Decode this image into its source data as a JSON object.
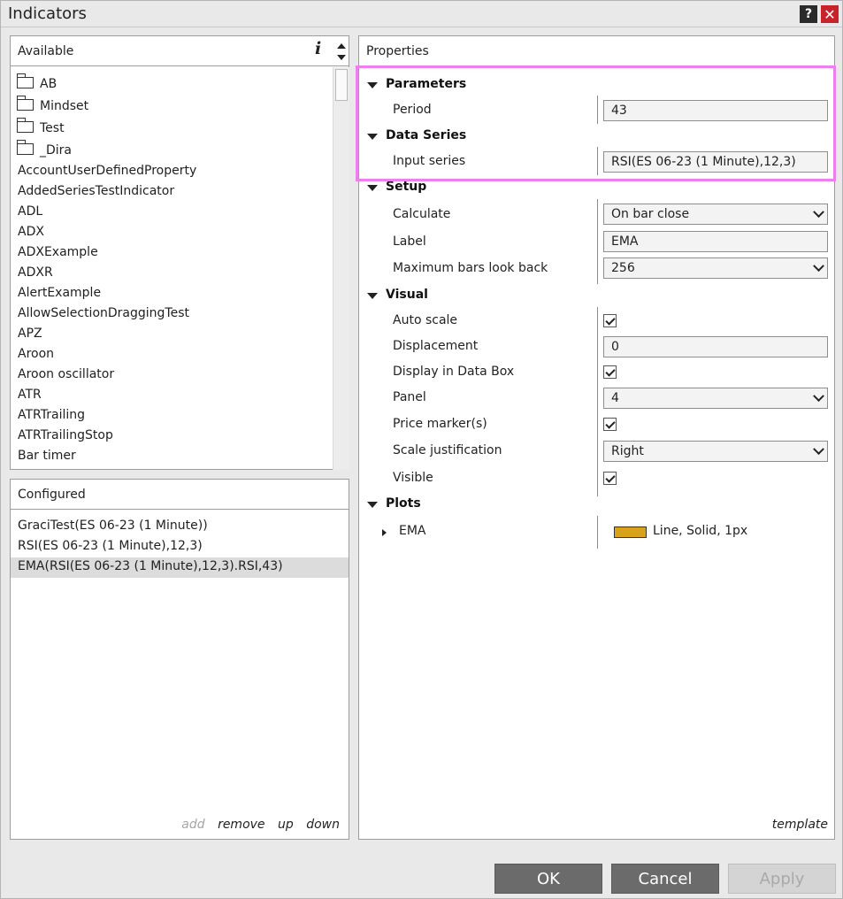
{
  "window": {
    "title": "Indicators",
    "help_icon": "?",
    "close_icon": "✕"
  },
  "available": {
    "header": "Available",
    "info_icon": "i",
    "folders": [
      "AB",
      "Mindset",
      "Test",
      "_Dira"
    ],
    "items": [
      "AccountUserDefinedProperty",
      "AddedSeriesTestIndicator",
      "ADL",
      "ADX",
      "ADXExample",
      "ADXR",
      "AlertExample",
      "AllowSelectionDraggingTest",
      "APZ",
      "Aroon",
      "Aroon oscillator",
      "ATR",
      "ATRTrailing",
      "ATRTrailingStop",
      "Bar timer"
    ]
  },
  "configured": {
    "header": "Configured",
    "items": [
      "GraciTest(ES 06-23 (1 Minute))",
      "RSI(ES 06-23 (1 Minute),12,3)",
      "EMA(RSI(ES 06-23 (1 Minute),12,3).RSI,43)"
    ],
    "selected_index": 2,
    "actions": {
      "add": "add",
      "remove": "remove",
      "up": "up",
      "down": "down"
    }
  },
  "properties": {
    "header": "Properties",
    "categories": {
      "parameters": "Parameters",
      "data_series": "Data Series",
      "setup": "Setup",
      "visual": "Visual",
      "plots": "Plots"
    },
    "fields": {
      "period": {
        "label": "Period",
        "value": "43"
      },
      "input_series": {
        "label": "Input series",
        "value": "RSI(ES 06-23 (1 Minute),12,3)"
      },
      "calculate": {
        "label": "Calculate",
        "value": "On bar close"
      },
      "label": {
        "label": "Label",
        "value": "EMA"
      },
      "max_bars": {
        "label": "Maximum bars look back",
        "value": "256"
      },
      "auto_scale": {
        "label": "Auto scale",
        "checked": true
      },
      "displacement": {
        "label": "Displacement",
        "value": "0"
      },
      "display_in_data_box": {
        "label": "Display in Data Box",
        "checked": true
      },
      "panel": {
        "label": "Panel",
        "value": "4"
      },
      "price_markers": {
        "label": "Price marker(s)",
        "checked": true
      },
      "scale_justification": {
        "label": "Scale justification",
        "value": "Right"
      },
      "visible": {
        "label": "Visible",
        "checked": true
      }
    },
    "plots": [
      {
        "label": "EMA",
        "color": "#d9a21b",
        "description": "Line, Solid, 1px"
      }
    ],
    "template_link": "template"
  },
  "buttons": {
    "ok": "OK",
    "cancel": "Cancel",
    "apply": "Apply"
  },
  "colors": {
    "highlight": "#ef7ff0",
    "button": "#6b6b6b",
    "close": "#c8232b"
  }
}
